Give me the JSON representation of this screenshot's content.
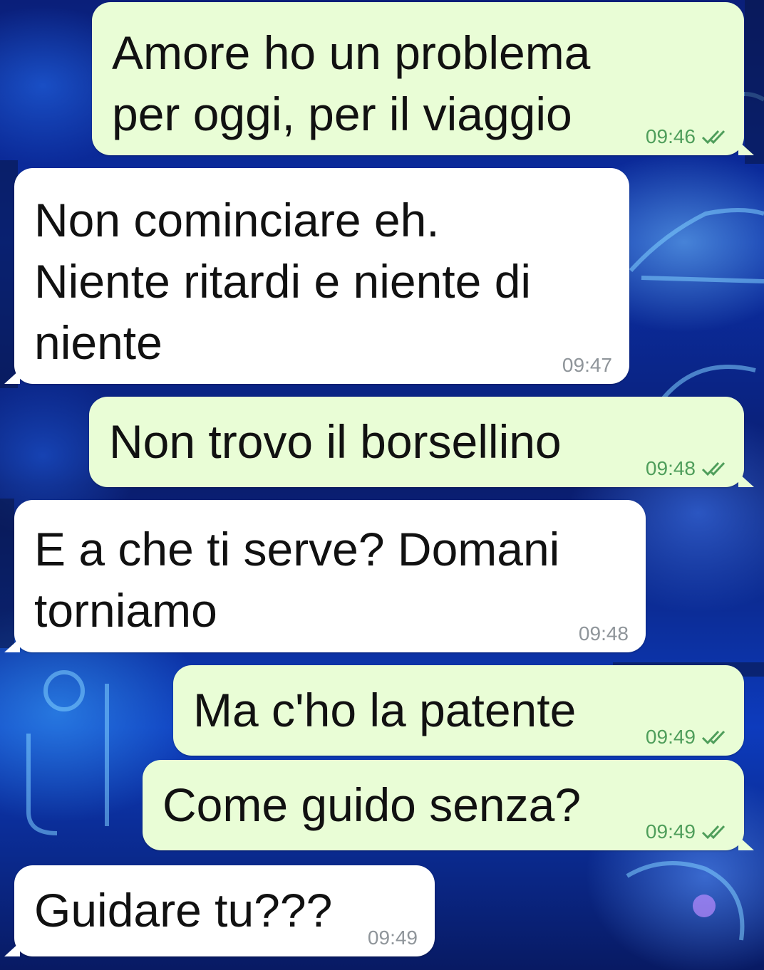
{
  "colors": {
    "outgoing_bubble": "#e9fdd6",
    "incoming_bubble": "#ffffff",
    "outgoing_meta": "#4f9e5b",
    "incoming_meta": "#8f959a",
    "read_ticks": "#4f9e5b"
  },
  "messages": [
    {
      "direction": "out",
      "text": "Amore ho un problema\nper oggi, per il viaggio",
      "time": "09:46",
      "status_icon": "double-check-icon"
    },
    {
      "direction": "in",
      "text": "Non cominciare eh.\nNiente ritardi e niente di\nniente",
      "time": "09:47"
    },
    {
      "direction": "out",
      "text": "Non trovo il borsellino",
      "time": "09:48",
      "status_icon": "double-check-icon"
    },
    {
      "direction": "in",
      "text": "E a che ti serve? Domani\ntorniamo",
      "time": "09:48"
    },
    {
      "direction": "out",
      "text": "Ma c'ho la patente",
      "time": "09:49",
      "status_icon": "double-check-icon"
    },
    {
      "direction": "out",
      "text": "Come guido senza?",
      "time": "09:49",
      "status_icon": "double-check-icon"
    },
    {
      "direction": "in",
      "text": "Guidare tu???",
      "time": "09:49"
    }
  ]
}
